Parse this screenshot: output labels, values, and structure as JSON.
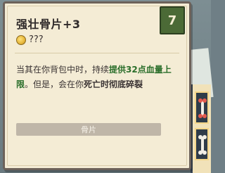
{
  "item": {
    "title": "强壮骨片+3",
    "cost": "7",
    "price": "???",
    "desc_parts": {
      "p1": "当其在你背包中时，持续",
      "p2": "提供32点血量上限",
      "p3": "。但是，会在你",
      "p4": "死亡时彻底碎裂"
    },
    "tag": "骨片"
  },
  "colors": {
    "panel": "#f4ecd5",
    "badge": "#4b6a36",
    "highlight": "#2a6e2a",
    "tag_bar": "#bfb6a8"
  },
  "icons": {
    "coin": "coin-icon",
    "bone": "bone-icon"
  }
}
